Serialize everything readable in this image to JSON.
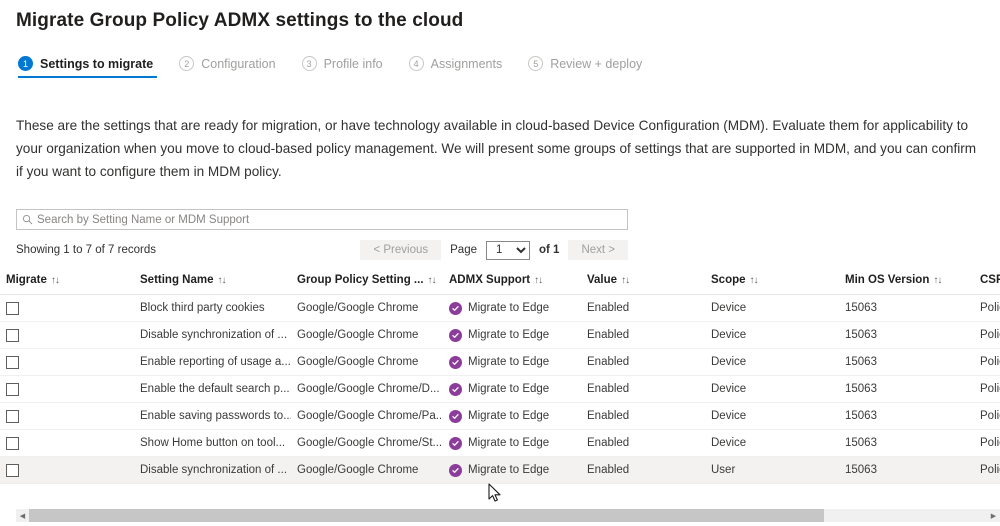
{
  "page_title": "Migrate Group Policy ADMX settings to the cloud",
  "wizard": {
    "steps": [
      {
        "num": "1",
        "label": "Settings to migrate",
        "active": true
      },
      {
        "num": "2",
        "label": "Configuration",
        "active": false
      },
      {
        "num": "3",
        "label": "Profile info",
        "active": false
      },
      {
        "num": "4",
        "label": "Assignments",
        "active": false
      },
      {
        "num": "5",
        "label": "Review + deploy",
        "active": false
      }
    ]
  },
  "description": "These are the settings that are ready for migration, or have technology available in cloud-based Device Configuration (MDM). Evaluate them for applicability to your organization when you move to cloud-based policy management. We will present some groups of settings that are supported in MDM, and you can confirm if you want to configure them in MDM policy.",
  "search": {
    "placeholder": "Search by Setting Name or MDM Support",
    "value": "",
    "icon": "search-icon"
  },
  "pagination": {
    "records_text": "Showing 1 to 7 of 7 records",
    "previous_label": "< Previous",
    "page_label": "Page",
    "page_value": "1",
    "page_options": [
      "1"
    ],
    "of_text": "of 1",
    "next_label": "Next >"
  },
  "table": {
    "sort_indicator": "↑↓",
    "columns": [
      "Migrate",
      "Setting Name",
      "Group Policy Setting ...",
      "ADMX Support",
      "Value",
      "Scope",
      "Min OS Version",
      "CSP Name"
    ],
    "rows": [
      {
        "checked": false,
        "setting_name": "Block third party cookies",
        "gp_setting": "Google/Google Chrome",
        "admx_support": "Migrate to Edge",
        "admx_icon": "check-circle-icon",
        "value": "Enabled",
        "scope": "Device",
        "min_os": "15063",
        "csp_name": "Policy",
        "hover": false
      },
      {
        "checked": false,
        "setting_name": "Disable synchronization of ...",
        "gp_setting": "Google/Google Chrome",
        "admx_support": "Migrate to Edge",
        "admx_icon": "check-circle-icon",
        "value": "Enabled",
        "scope": "Device",
        "min_os": "15063",
        "csp_name": "Policy",
        "hover": false
      },
      {
        "checked": false,
        "setting_name": "Enable reporting of usage a...",
        "gp_setting": "Google/Google Chrome",
        "admx_support": "Migrate to Edge",
        "admx_icon": "check-circle-icon",
        "value": "Enabled",
        "scope": "Device",
        "min_os": "15063",
        "csp_name": "Policy",
        "hover": false
      },
      {
        "checked": false,
        "setting_name": "Enable the default search p...",
        "gp_setting": "Google/Google Chrome/D...",
        "admx_support": "Migrate to Edge",
        "admx_icon": "check-circle-icon",
        "value": "Enabled",
        "scope": "Device",
        "min_os": "15063",
        "csp_name": "Policy",
        "hover": false
      },
      {
        "checked": false,
        "setting_name": "Enable saving passwords to...",
        "gp_setting": "Google/Google Chrome/Pa...",
        "admx_support": "Migrate to Edge",
        "admx_icon": "check-circle-icon",
        "value": "Enabled",
        "scope": "Device",
        "min_os": "15063",
        "csp_name": "Policy",
        "hover": false
      },
      {
        "checked": false,
        "setting_name": "Show Home button on tool...",
        "gp_setting": "Google/Google Chrome/St...",
        "admx_support": "Migrate to Edge",
        "admx_icon": "check-circle-icon",
        "value": "Enabled",
        "scope": "Device",
        "min_os": "15063",
        "csp_name": "Policy",
        "hover": false
      },
      {
        "checked": false,
        "setting_name": "Disable synchronization of ...",
        "gp_setting": "Google/Google Chrome",
        "admx_support": "Migrate to Edge",
        "admx_icon": "check-circle-icon",
        "value": "Enabled",
        "scope": "User",
        "min_os": "15063",
        "csp_name": "Policy",
        "hover": true
      }
    ]
  },
  "colors": {
    "accent": "#0078d4",
    "admx_badge": "#8c3c9b",
    "row_hover": "#f3f2f1",
    "text": "#323130"
  }
}
